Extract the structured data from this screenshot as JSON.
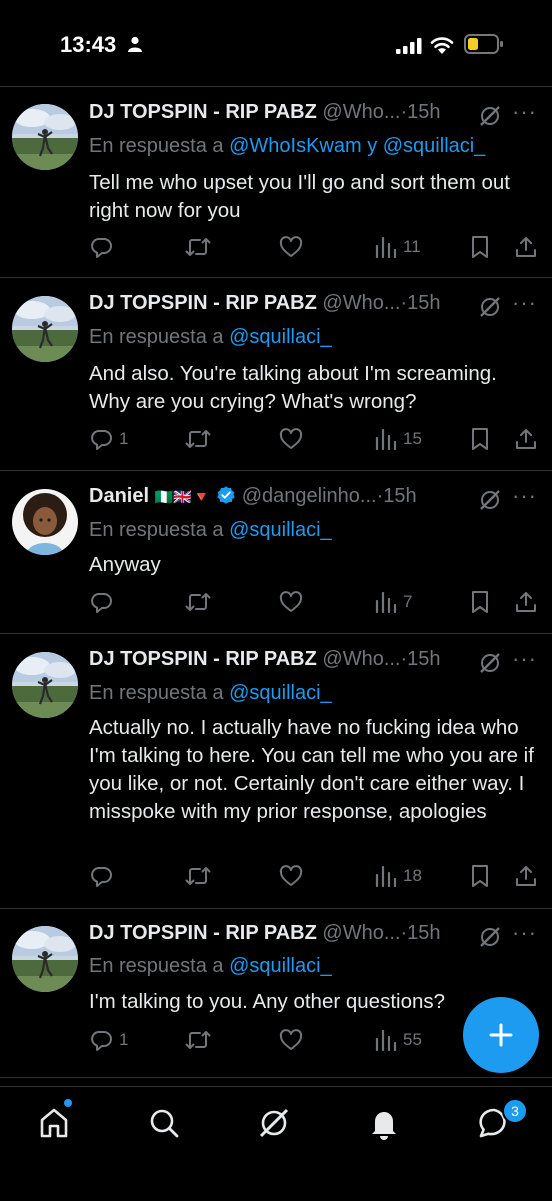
{
  "status_bar": {
    "time": "13:43"
  },
  "tweets": [
    {
      "name": "DJ TOPSPIN - RIP PABZ",
      "flags": "",
      "handle": "@Who...",
      "dot": "·",
      "time": "15h",
      "reply_prefix": "En respuesta a",
      "reply_to": "@WhoIsKwam y @squillaci_",
      "text": "Tell me who upset you I'll go and sort them out right now for you",
      "replies": "",
      "views": "11"
    },
    {
      "name": "DJ TOPSPIN - RIP PABZ",
      "flags": "",
      "handle": "@Who...",
      "dot": "·",
      "time": "15h",
      "reply_prefix": "En respuesta a",
      "reply_to": "@squillaci_",
      "text": "And also. You're talking about I'm screaming. Why are you crying? What's wrong?",
      "replies": "1",
      "views": "15"
    },
    {
      "name": "Daniel",
      "flags": "🇳🇬🇬🇧🔻",
      "handle": "@dangelinho...",
      "dot": "·",
      "time": "15h",
      "reply_prefix": "En respuesta a",
      "reply_to": "@squillaci_",
      "text": "Anyway",
      "replies": "",
      "views": "7"
    },
    {
      "name": "DJ TOPSPIN - RIP PABZ",
      "flags": "",
      "handle": "@Who...",
      "dot": "·",
      "time": "15h",
      "reply_prefix": "En respuesta a",
      "reply_to": "@squillaci_",
      "text": "Actually no. I actually have no fucking idea who I'm talking to here. You can tell me who you are if you like, or not. Certainly don't care either way. I misspoke with my prior response, apologies",
      "replies": "",
      "views": "18"
    },
    {
      "name": "DJ TOPSPIN - RIP PABZ",
      "flags": "",
      "handle": "@Who...",
      "dot": "·",
      "time": "15h",
      "reply_prefix": "En respuesta a",
      "reply_to": "@squillaci_",
      "text": "I'm talking to you. Any other questions?",
      "replies": "1",
      "views": "55"
    }
  ],
  "nav": {
    "messages_badge": "3"
  },
  "colors": {
    "accent": "#1d9bf0",
    "background": "#000000",
    "muted": "#71767b",
    "text": "#e7e9ea"
  },
  "icons": [
    "person-icon",
    "signal-icon",
    "wifi-icon",
    "battery-icon",
    "verified-icon",
    "grok-icon",
    "more-icon",
    "reply-icon",
    "retweet-icon",
    "like-icon",
    "views-icon",
    "bookmark-icon",
    "share-icon",
    "compose-icon",
    "home-icon",
    "search-icon",
    "bell-icon",
    "messages-icon"
  ]
}
